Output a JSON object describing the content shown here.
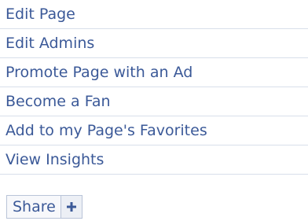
{
  "menu": {
    "items": [
      {
        "label": "Edit Page"
      },
      {
        "label": "Edit Admins"
      },
      {
        "label": "Promote Page with an Ad"
      },
      {
        "label": "Become a Fan"
      },
      {
        "label": "Add to my Page's Favorites"
      },
      {
        "label": "View Insights"
      }
    ]
  },
  "share": {
    "label": "Share",
    "plus_icon": "plus-icon"
  },
  "colors": {
    "link": "#3b5998",
    "divider": "#d8dfea",
    "share_border": "#b9c4d8"
  }
}
